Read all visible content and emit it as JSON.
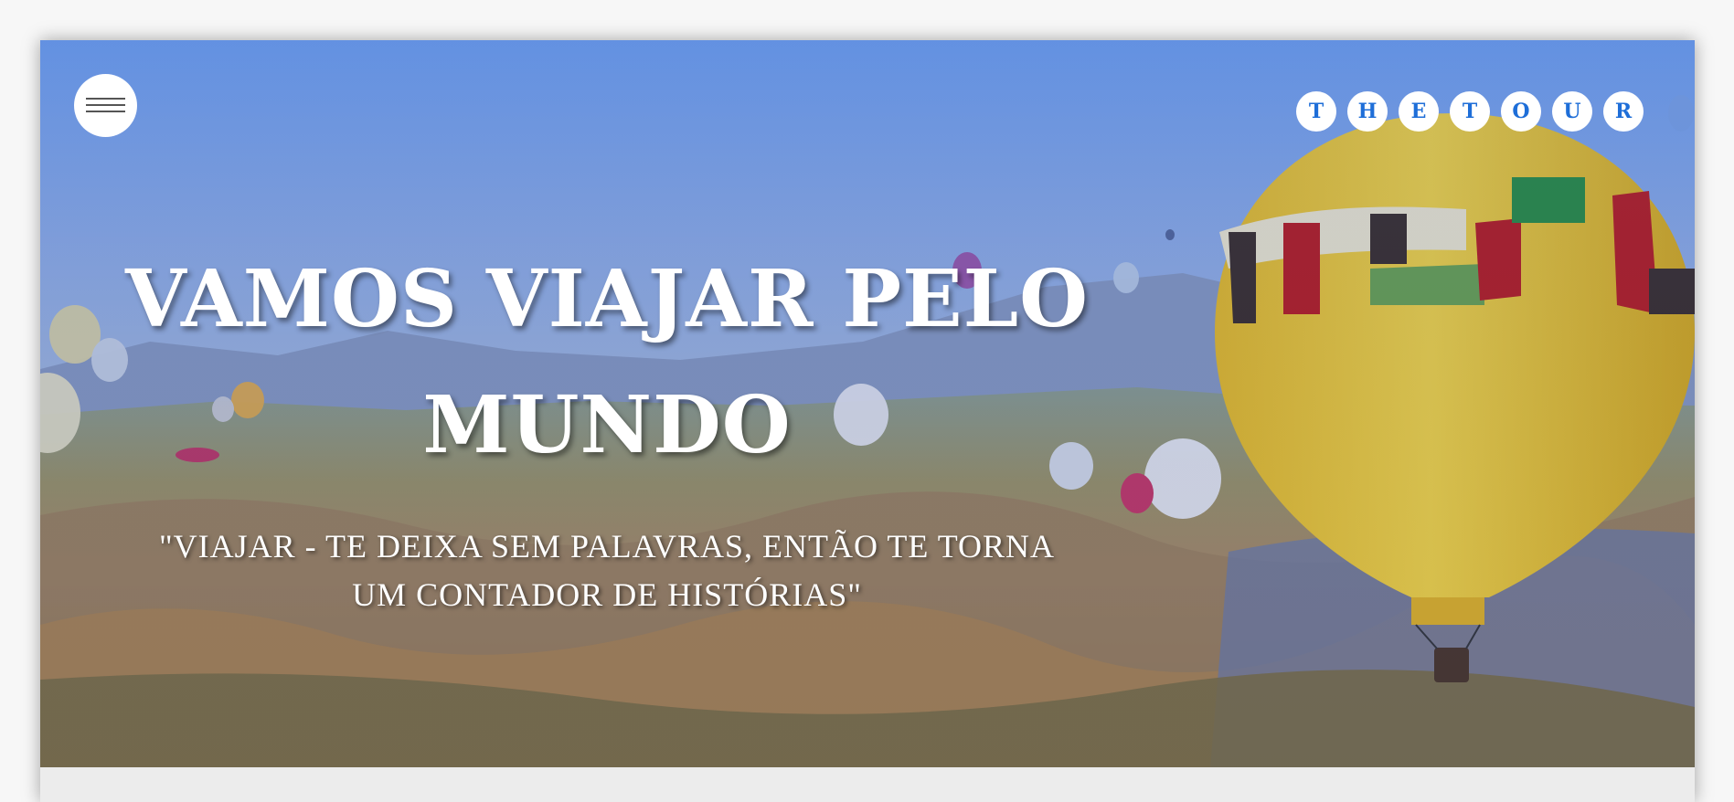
{
  "header": {
    "menu_icon": "hamburger-icon",
    "logo_letters": [
      "T",
      "H",
      "E",
      "T",
      "O",
      "U",
      "R"
    ]
  },
  "hero": {
    "headline": "VAMOS VIAJAR PELO MUNDO",
    "quote": "\"VIAJAR - TE DEIXA SEM PALAVRAS, ENTÃO TE TORNA UM CONTADOR DE HISTÓRIAS\""
  },
  "colors": {
    "accent": "#1e6ed8",
    "text_on_hero": "#ffffff",
    "page_background": "#ececec"
  }
}
